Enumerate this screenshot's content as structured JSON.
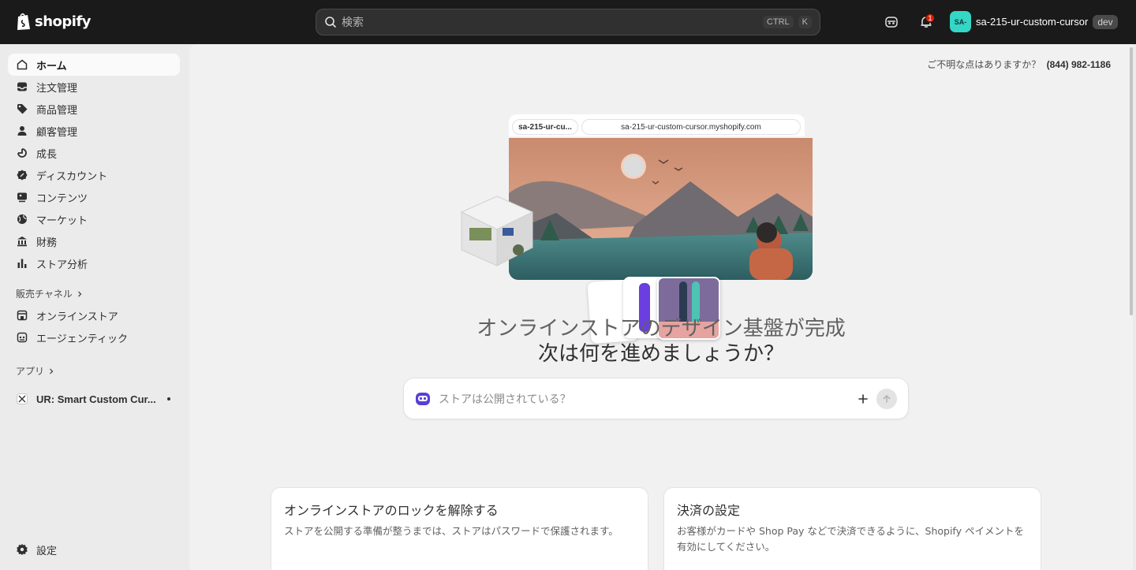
{
  "topbar": {
    "logo_text": "shopify",
    "search": {
      "placeholder": "検索",
      "shortcut_mod": "CTRL",
      "shortcut_key": "K"
    },
    "notification_count": "1",
    "store": {
      "avatar_text": "SA-",
      "name": "sa-215-ur-custom-cursor",
      "badge": "dev"
    }
  },
  "sidebar": {
    "items": [
      {
        "label": "ホーム",
        "icon": "home-icon",
        "active": true
      },
      {
        "label": "注文管理",
        "icon": "inbox-icon"
      },
      {
        "label": "商品管理",
        "icon": "tag-icon"
      },
      {
        "label": "顧客管理",
        "icon": "person-icon"
      },
      {
        "label": "成長",
        "icon": "growth-icon"
      },
      {
        "label": "ディスカウント",
        "icon": "discount-icon"
      },
      {
        "label": "コンテンツ",
        "icon": "content-icon"
      },
      {
        "label": "マーケット",
        "icon": "globe-icon"
      },
      {
        "label": "財務",
        "icon": "bank-icon"
      },
      {
        "label": "ストア分析",
        "icon": "bar-chart-icon"
      }
    ],
    "sales_channels_label": "販売チャネル",
    "channels": [
      {
        "label": "オンラインストア",
        "icon": "store-icon"
      },
      {
        "label": "エージェンティック",
        "icon": "agentic-icon"
      }
    ],
    "apps_label": "アプリ",
    "apps": [
      {
        "label": "UR: Smart Custom Cur..."
      }
    ],
    "settings_label": "設定"
  },
  "main": {
    "help_text": "ご不明な点はありますか？",
    "help_phone": "(844) 982-1186",
    "illustration": {
      "tab_label": "sa-215-ur-cu...",
      "url": "sa-215-ur-custom-cursor.myshopify.com"
    },
    "headline_line1": "オンラインストアのデザイン基盤が完成",
    "headline_line2": "次は何を進めましょうか？",
    "prompt_placeholder": "ストアは公開されている？",
    "cards": [
      {
        "title": "オンラインストアのロックを解除する",
        "description": "ストアを公開する準備が整うまでは、ストアはパスワードで保護されます。"
      },
      {
        "title": "決済の設定",
        "description": "お客様がカードや Shop Pay などで決済できるように、Shopify ペイメントを有効にしてください。"
      }
    ]
  }
}
